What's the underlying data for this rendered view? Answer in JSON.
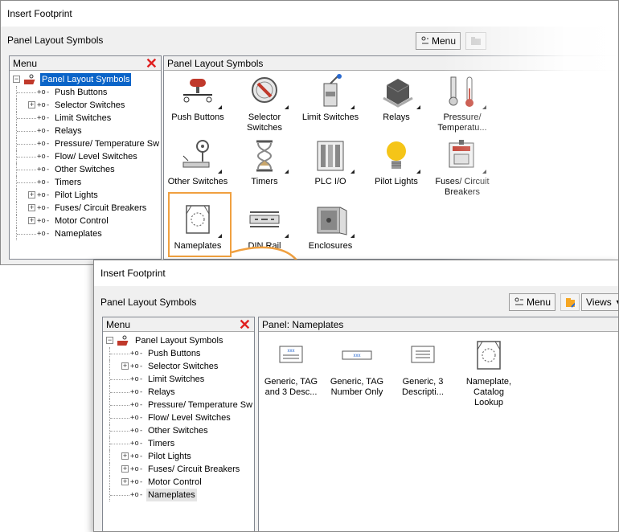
{
  "window1": {
    "title": "Insert Footprint",
    "subtitle": "Panel Layout Symbols",
    "menu_button_label": "Menu",
    "tree_header": "Menu",
    "content_header": "Panel Layout Symbols",
    "tree": [
      {
        "label": "Panel Layout Symbols",
        "root": true,
        "selected": true
      },
      {
        "label": "Push Buttons",
        "expandable": false
      },
      {
        "label": "Selector Switches",
        "expandable": true
      },
      {
        "label": "Limit Switches",
        "expandable": false
      },
      {
        "label": "Relays",
        "expandable": false
      },
      {
        "label": "Pressure/ Temperature Sw",
        "expandable": false
      },
      {
        "label": "Flow/ Level Switches",
        "expandable": false
      },
      {
        "label": "Other Switches",
        "expandable": false
      },
      {
        "label": "Timers",
        "expandable": false
      },
      {
        "label": "Pilot Lights",
        "expandable": true
      },
      {
        "label": "Fuses/ Circuit Breakers",
        "expandable": true
      },
      {
        "label": "Motor Control",
        "expandable": true
      },
      {
        "label": "Nameplates",
        "expandable": false
      }
    ],
    "grid": [
      {
        "label": "Push Buttons",
        "icon": "push-button-icon"
      },
      {
        "label": "Selector Switches",
        "icon": "selector-switch-icon"
      },
      {
        "label": "Limit Switches",
        "icon": "limit-switch-icon"
      },
      {
        "label": "Relays",
        "icon": "relay-icon"
      },
      {
        "label": "Pressure/ Temperatu...",
        "icon": "thermometer-icon"
      },
      {
        "label": "Other Switches",
        "icon": "other-switch-icon"
      },
      {
        "label": "Timers",
        "icon": "hourglass-icon"
      },
      {
        "label": "PLC I/O",
        "icon": "plc-icon"
      },
      {
        "label": "Pilot Lights",
        "icon": "light-bulb-icon"
      },
      {
        "label": "Fuses/ Circuit Breakers",
        "icon": "fuse-icon"
      },
      {
        "label": "Nameplates",
        "icon": "nameplate-icon"
      },
      {
        "label": "DIN Rail",
        "icon": "din-rail-icon"
      },
      {
        "label": "Enclosures",
        "icon": "enclosure-icon"
      }
    ]
  },
  "window2": {
    "title": "Insert Footprint",
    "subtitle": "Panel Layout Symbols",
    "menu_button_label": "Menu",
    "views_button_label": "Views",
    "tree_header": "Menu",
    "content_header": "Panel: Nameplates",
    "tree": [
      {
        "label": "Panel Layout Symbols",
        "root": true,
        "selected": false
      },
      {
        "label": "Push Buttons",
        "expandable": false
      },
      {
        "label": "Selector Switches",
        "expandable": true
      },
      {
        "label": "Limit Switches",
        "expandable": false
      },
      {
        "label": "Relays",
        "expandable": false
      },
      {
        "label": "Pressure/ Temperature Sw",
        "expandable": false
      },
      {
        "label": "Flow/ Level Switches",
        "expandable": false
      },
      {
        "label": "Other Switches",
        "expandable": false
      },
      {
        "label": "Timers",
        "expandable": false
      },
      {
        "label": "Pilot Lights",
        "expandable": true
      },
      {
        "label": "Fuses/ Circuit Breakers",
        "expandable": true
      },
      {
        "label": "Motor Control",
        "expandable": true
      },
      {
        "label": "Nameplates",
        "expandable": false,
        "highlight": true
      }
    ],
    "grid": [
      {
        "label": "Generic, TAG and 3 Desc...",
        "icon": "nameplate-xxx-icon"
      },
      {
        "label": "Generic, TAG Number Only",
        "icon": "nameplate-tag-icon"
      },
      {
        "label": "Generic, 3 Descripti...",
        "icon": "nameplate-lines-icon"
      },
      {
        "label": "Nameplate, Catalog Lookup",
        "icon": "nameplate-catalog-icon"
      }
    ]
  },
  "colors": {
    "accent": "#f0a040",
    "selection": "#0a64c8",
    "close": "#e02020"
  }
}
